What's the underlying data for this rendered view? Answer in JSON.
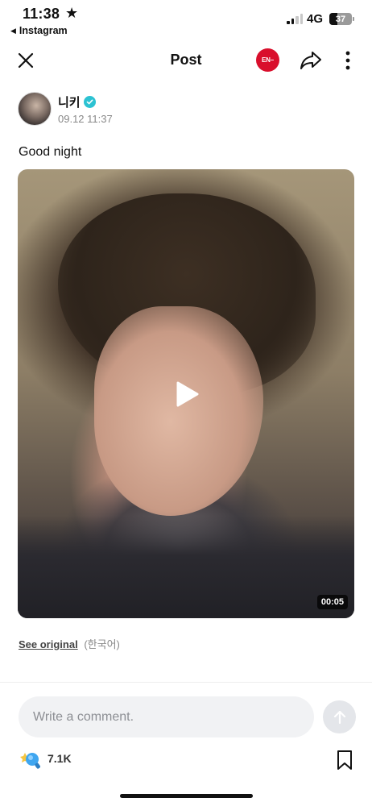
{
  "status_bar": {
    "time": "11:38",
    "star": "★",
    "back_arrow": "◀",
    "back_app": "Instagram",
    "network": "4G",
    "battery": "37",
    "battery_level": 0.37
  },
  "header": {
    "title": "Post",
    "badge_label": "EN−",
    "badge_color": "#d90f2c",
    "icons": [
      "close-icon",
      "share-icon",
      "more-icon"
    ]
  },
  "post": {
    "author": "니키",
    "verified_color": "#2cc2d2",
    "date": "09.12 11:37",
    "text": "Good night",
    "video_duration": "00:05",
    "see_original": "See original",
    "original_language": "(한국어)"
  },
  "comment": {
    "placeholder": "Write a comment."
  },
  "reactions": {
    "count": "7.1K",
    "icons": [
      "reaction-emoji-icon",
      "bookmark-icon"
    ]
  }
}
